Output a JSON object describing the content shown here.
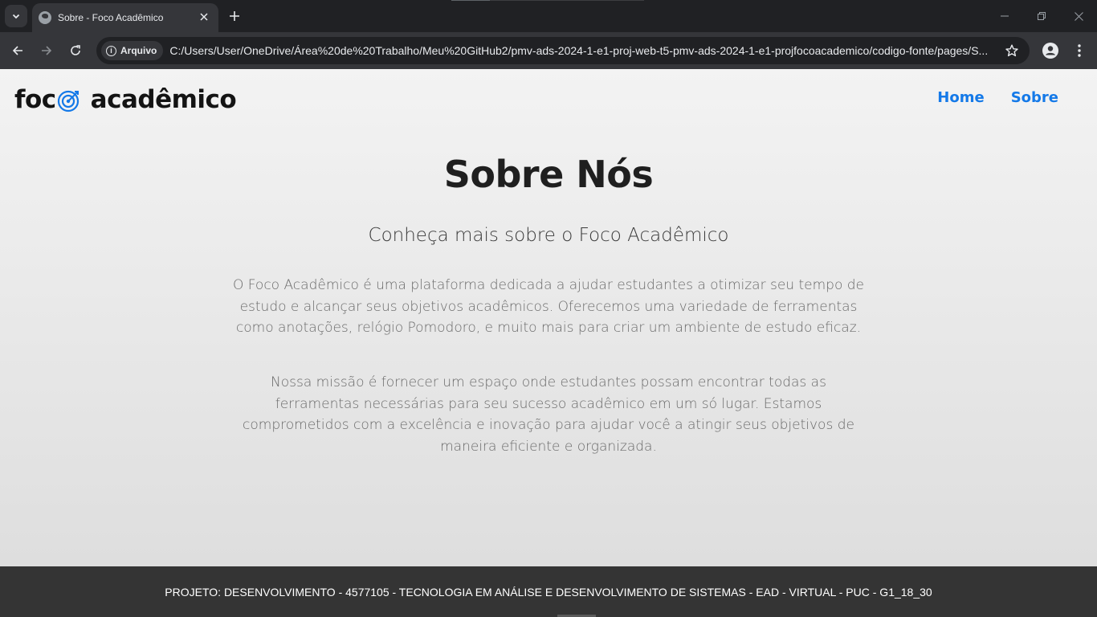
{
  "browser": {
    "tab_title": "Sobre - Foco Acadêmico",
    "security_chip": "Arquivo",
    "url": "C:/Users/User/OneDrive/Área%20de%20Trabalho/Meu%20GitHub2/pmv-ads-2024-1-e1-proj-web-t5-pmv-ads-2024-1-e1-projfocoacademico/codigo-fonte/pages/S..."
  },
  "header": {
    "brand_left": "foc",
    "brand_right": "acadêmico",
    "brand_accent": "#1479e8",
    "nav": [
      {
        "label": "Home"
      },
      {
        "label": "Sobre"
      }
    ]
  },
  "main": {
    "title": "Sobre Nós",
    "subtitle": "Conheça mais sobre o Foco Acadêmico",
    "paragraphs": [
      "O Foco Acadêmico é uma plataforma dedicada a ajudar estudantes a otimizar seu tempo de estudo e alcançar seus objetivos acadêmicos. Oferecemos uma variedade de ferramentas como anotações, relógio Pomodoro, e muito mais para criar um ambiente de estudo eficaz.",
      "Nossa missão é fornecer um espaço onde estudantes possam encontrar todas as ferramentas necessárias para seu sucesso acadêmico em um só lugar. Estamos comprometidos com a excelência e inovação para ajudar você a atingir seus objetivos de maneira eficiente e organizada."
    ]
  },
  "footer": {
    "text": "PROJETO: DESENVOLVIMENTO - 4577105 - TECNOLOGIA EM ANÁLISE E DESENVOLVIMENTO DE SISTEMAS - EAD - VIRTUAL - PUC - G1_18_30"
  }
}
